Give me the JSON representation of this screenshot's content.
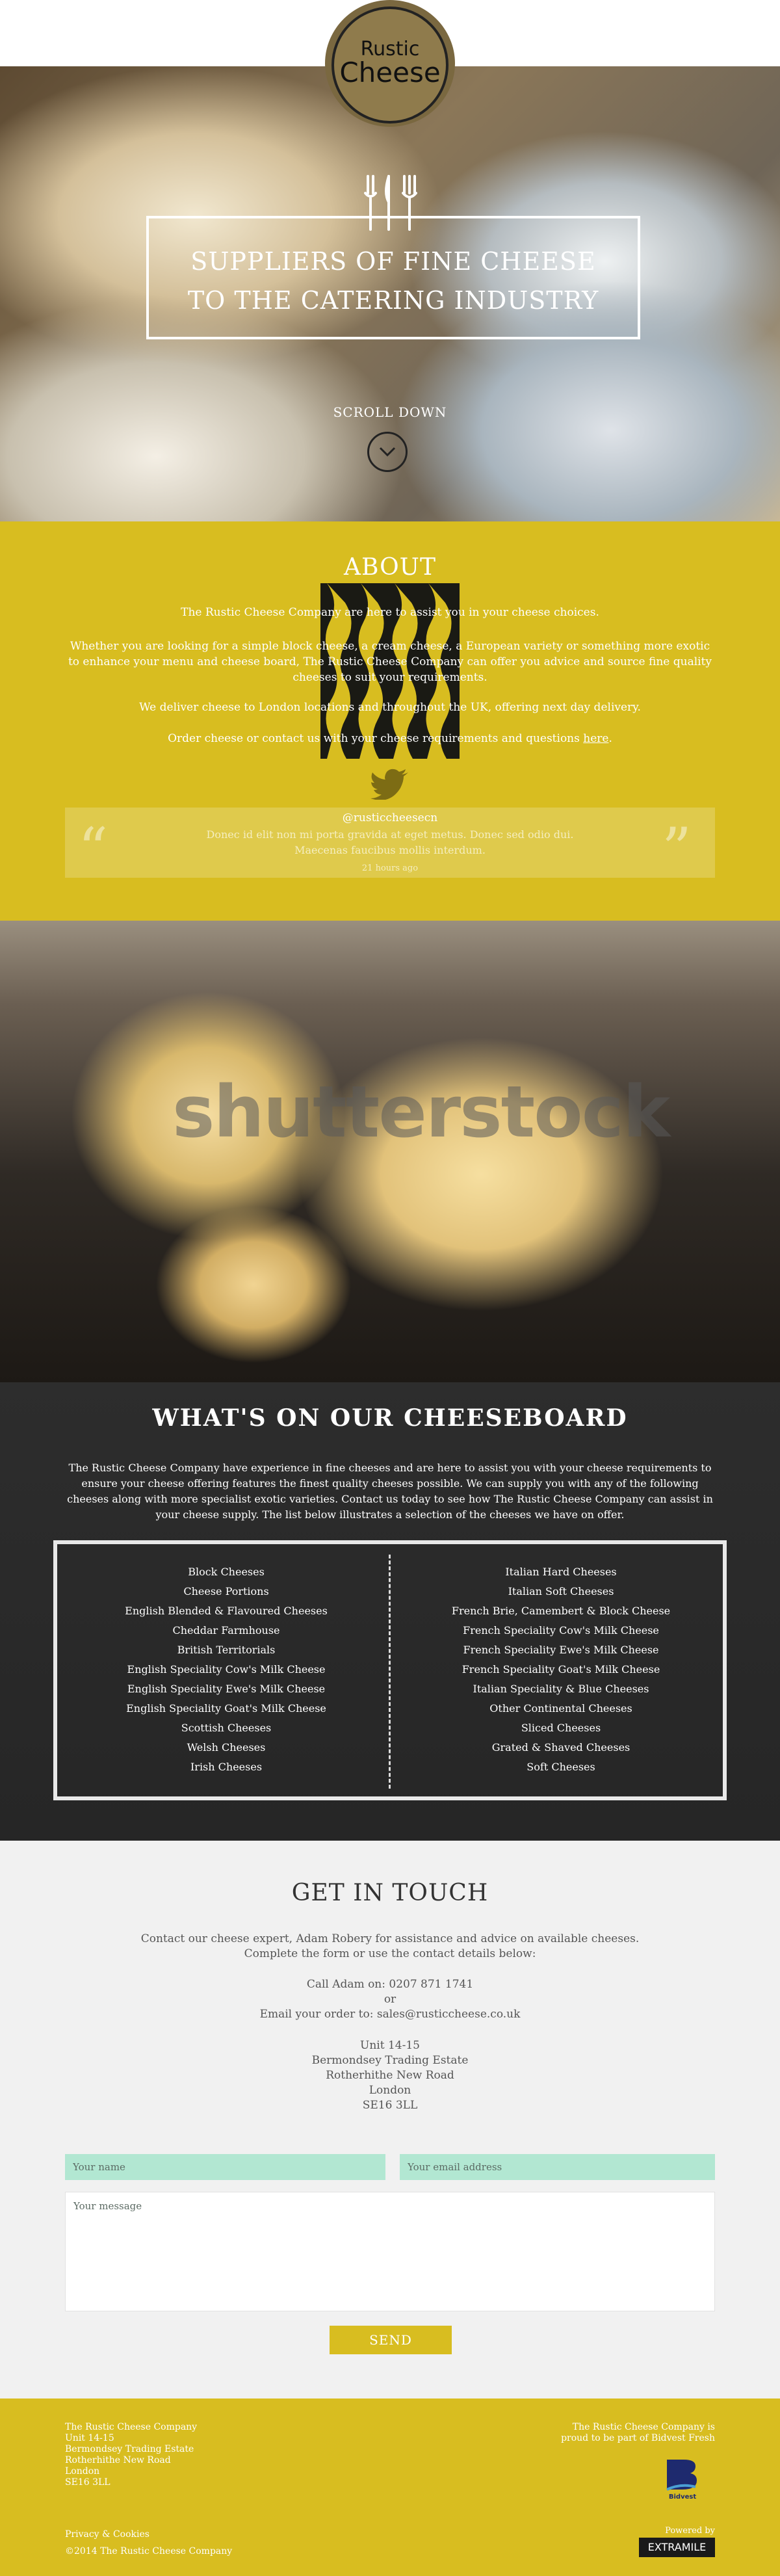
{
  "logo": {
    "line1": "Rustic",
    "line2": "Cheese"
  },
  "hero": {
    "title_line1": "SUPPLIERS OF FINE CHEESE",
    "title_line2": "TO THE CATERING INDUSTRY",
    "scroll_label": "SCROLL DOWN"
  },
  "about": {
    "heading": "ABOUT",
    "p1": "The Rustic Cheese Company are here to assist you in your cheese choices.",
    "p2": "Whether you are looking for a simple block cheese, a cream cheese, a European variety or something more exotic to enhance your menu and cheese board, The Rustic Cheese Company can offer you advice and source fine quality cheeses to suit your requirements.",
    "p3": "We deliver cheese to London locations and throughout the UK, offering next day delivery.",
    "p4_prefix": "Order cheese or contact us with your cheese requirements and questions ",
    "p4_link": "here",
    "p4_suffix": ".",
    "tweet": {
      "handle": "@rusticcheesecn",
      "body": "Donec id elit non mi porta gravida at eget metus. Donec sed odio dui. Maecenas faucibus mollis interdum.",
      "time": "21 hours ago"
    }
  },
  "photo": {
    "watermark": "shutterstock"
  },
  "cheeseboard": {
    "heading": "WHAT'S ON OUR CHEESEBOARD",
    "intro": "The Rustic Cheese Company have experience in fine cheeses and are here to assist you with your cheese requirements to ensure your cheese offering features the finest quality cheeses possible.  We can supply you with any of the following cheeses along with more specialist exotic varieties.  Contact us today to see how The Rustic Cheese Company can assist in your cheese supply. The list below illustrates a selection of the cheeses we have on offer.",
    "left": [
      "Block Cheeses",
      "Cheese Portions",
      "English Blended & Flavoured Cheeses",
      "Cheddar Farmhouse",
      "British Territorials",
      "English Speciality Cow's Milk Cheese",
      "English Speciality Ewe's Milk Cheese",
      "English Speciality Goat's Milk Cheese",
      "Scottish Cheeses",
      "Welsh Cheeses",
      "Irish Cheeses"
    ],
    "right": [
      "Italian Hard Cheeses",
      "Italian Soft Cheeses",
      "French Brie, Camembert & Block Cheese",
      "French Speciality Cow's Milk Cheese",
      "French Speciality Ewe's Milk Cheese",
      "French Speciality Goat's Milk Cheese",
      "Italian Speciality & Blue Cheeses",
      "Other Continental Cheeses",
      "Sliced Cheeses",
      "Grated & Shaved Cheeses",
      "Soft Cheeses"
    ]
  },
  "contact": {
    "heading": "GET IN TOUCH",
    "intro1": "Contact our cheese expert,  Adam Robery for assistance and advice on available cheeses.",
    "intro2": "Complete the form or use the contact details below:",
    "call": "Call Adam on:  0207 871 1741",
    "or": "or",
    "email": "Email your order to:  sales@rusticcheese.co.uk",
    "address": [
      "Unit 14-15",
      "Bermondsey Trading Estate",
      "Rotherhithe New Road",
      "London",
      "SE16 3LL"
    ],
    "name_placeholder": "Your name",
    "email_placeholder": "Your email address",
    "message_placeholder": "Your message",
    "send_label": "SEND"
  },
  "footer": {
    "address": [
      "The Rustic Cheese Company",
      "Unit 14-15",
      "Bermondsey Trading Estate",
      "Rotherhithe New Road",
      "London",
      "SE16 3LL"
    ],
    "bidvest_note": "The Rustic Cheese Company is proud to be part of Bidvest Fresh",
    "bidvest_label": "Bidvest",
    "privacy_link": "Privacy & Cookies",
    "copyright": "©2014 The Rustic Cheese Company",
    "powered_by": "Powered by",
    "extra_label": "EXTRAMILE"
  },
  "colors": {
    "accent_yellow": "#d8bd20",
    "board_dark": "#2a2a2a",
    "input_mint": "#b2e7d2"
  }
}
